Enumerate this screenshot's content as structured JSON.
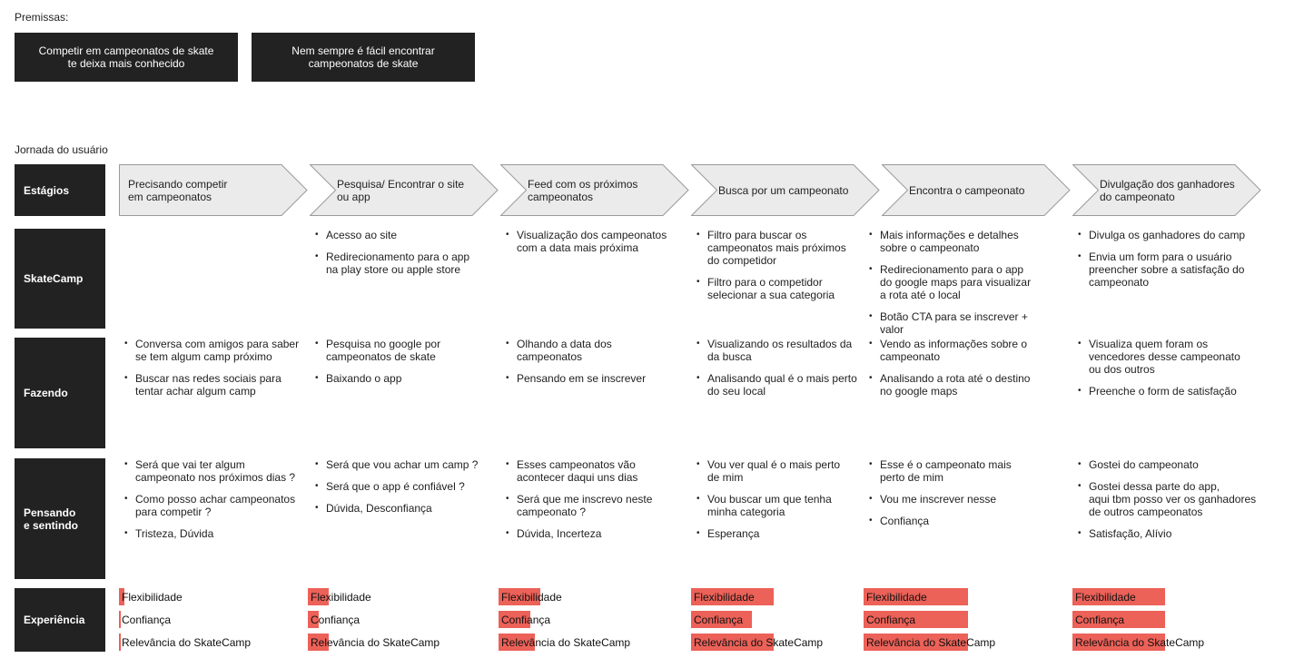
{
  "premissas": {
    "title": "Premissas:",
    "items": [
      "Competir em campeonatos de skate\nte deixa mais conhecido",
      "Nem sempre é fácil encontrar\ncampeonatos de skate"
    ]
  },
  "jornada": {
    "title": "Jornada do usuário",
    "row_labels": {
      "estagios": "Estágios",
      "skatecamp": "SkateCamp",
      "fazendo": "Fazendo",
      "pensando": "Pensando\ne sentindo",
      "experiencia": "Experiência"
    },
    "accent_color": "#ec6158",
    "stage_fill": "#ebebeb",
    "stages": [
      {
        "title": "Precisando competir\nem campeonatos",
        "skatecamp": [],
        "fazendo": [
          "Conversa com amigos para saber\nse tem algum camp próximo",
          "Buscar nas redes sociais para\ntentar achar algum camp"
        ],
        "pensando": [
          "Será que vai ter algum\ncampeonato nos próximos dias ?",
          "Como posso achar campeonatos\npara competir ?",
          "Tristeza, Dúvida"
        ],
        "experiencia": [
          {
            "label": "Flexibilidade",
            "level": 0.05
          },
          {
            "label": "Confiança",
            "level": 0.01
          },
          {
            "label": "Relevância do SkateCamp",
            "level": 0.01
          }
        ]
      },
      {
        "title": "Pesquisa/ Encontrar o site\nou app",
        "skatecamp": [
          "Acesso ao site",
          "Redirecionamento para o app\nna play store ou apple store"
        ],
        "fazendo": [
          "Pesquisa no google por\ncampeonatos de skate",
          "Baixando o app"
        ],
        "pensando": [
          "Será que vou achar um camp ?",
          "Será que o app é confiável ?",
          "Dúvida, Desconfiança"
        ],
        "experiencia": [
          {
            "label": "Flexibilidade",
            "level": 0.2
          },
          {
            "label": "Confiança",
            "level": 0.1
          },
          {
            "label": "Relevância do SkateCamp",
            "level": 0.2
          }
        ]
      },
      {
        "title": "Feed com os próximos\ncampeonatos",
        "skatecamp": [
          "Visualização dos campeonatos\ncom a data mais próxima"
        ],
        "fazendo": [
          "Olhando a data dos\ncampeonatos",
          "Pensando em se inscrever"
        ],
        "pensando": [
          "Esses campeonatos vão\nacontecer daqui uns dias",
          "Será que me inscrevo neste\ncampeonato ?",
          "Dúvida, Incerteza"
        ],
        "experiencia": [
          {
            "label": "Flexibilidade",
            "level": 0.4
          },
          {
            "label": "Confiança",
            "level": 0.3
          },
          {
            "label": "Relevância do SkateCamp",
            "level": 0.35
          }
        ]
      },
      {
        "title": "Busca por um campeonato",
        "skatecamp": [
          "Filtro para buscar os\ncampeonatos mais próximos\ndo competidor",
          "Filtro para o competidor\nselecionar a sua categoria"
        ],
        "fazendo": [
          "Visualizando os resultados da\nda busca",
          "Analisando qual é o mais perto\ndo seu local"
        ],
        "pensando": [
          "Vou ver qual é o mais perto\nde mim",
          "Vou buscar um que tenha\nminha categoria",
          "Esperança"
        ],
        "experiencia": [
          {
            "label": "Flexibilidade",
            "level": 0.95
          },
          {
            "label": "Confiança",
            "level": 0.7
          },
          {
            "label": "Relevância do SkateCamp",
            "level": 0.95
          }
        ]
      },
      {
        "title": "Encontra o campeonato",
        "skatecamp": [
          "Mais informações e detalhes\nsobre o campeonato",
          "Redirecionamento para o app\ndo google maps para visualizar\na rota até o local",
          "Botão CTA para se inscrever + valor"
        ],
        "fazendo": [
          "Vendo as informações sobre o\ncampeonato",
          "Analisando a rota até o destino\nno google maps"
        ],
        "pensando": [
          "Esse é o campeonato mais\nperto de mim",
          "Vou me inscrever nesse",
          "Confiança"
        ],
        "experiencia": [
          {
            "label": "Flexibilidade",
            "level": 1.0
          },
          {
            "label": "Confiança",
            "level": 1.0
          },
          {
            "label": "Relevância do SkateCamp",
            "level": 1.0
          }
        ]
      },
      {
        "title": "Divulgação dos ganhadores\ndo campeonato",
        "skatecamp": [
          "Divulga os ganhadores do camp",
          "Envia um form para o usuário\npreencher sobre a satisfação do\ncampeonato"
        ],
        "fazendo": [
          "Visualiza quem foram os\nvencedores desse campeonato\nou dos outros",
          "Preenche o form de satisfação"
        ],
        "pensando": [
          "Gostei do campeonato",
          "Gostei dessa parte do app,\naqui tbm posso ver os ganhadores\nde outros campeonatos",
          "Satisfação, Alívio"
        ],
        "experiencia": [
          {
            "label": "Flexibilidade",
            "level": 1.0
          },
          {
            "label": "Confiança",
            "level": 1.0
          },
          {
            "label": "Relevância do SkateCamp",
            "level": 1.0
          }
        ]
      }
    ]
  }
}
